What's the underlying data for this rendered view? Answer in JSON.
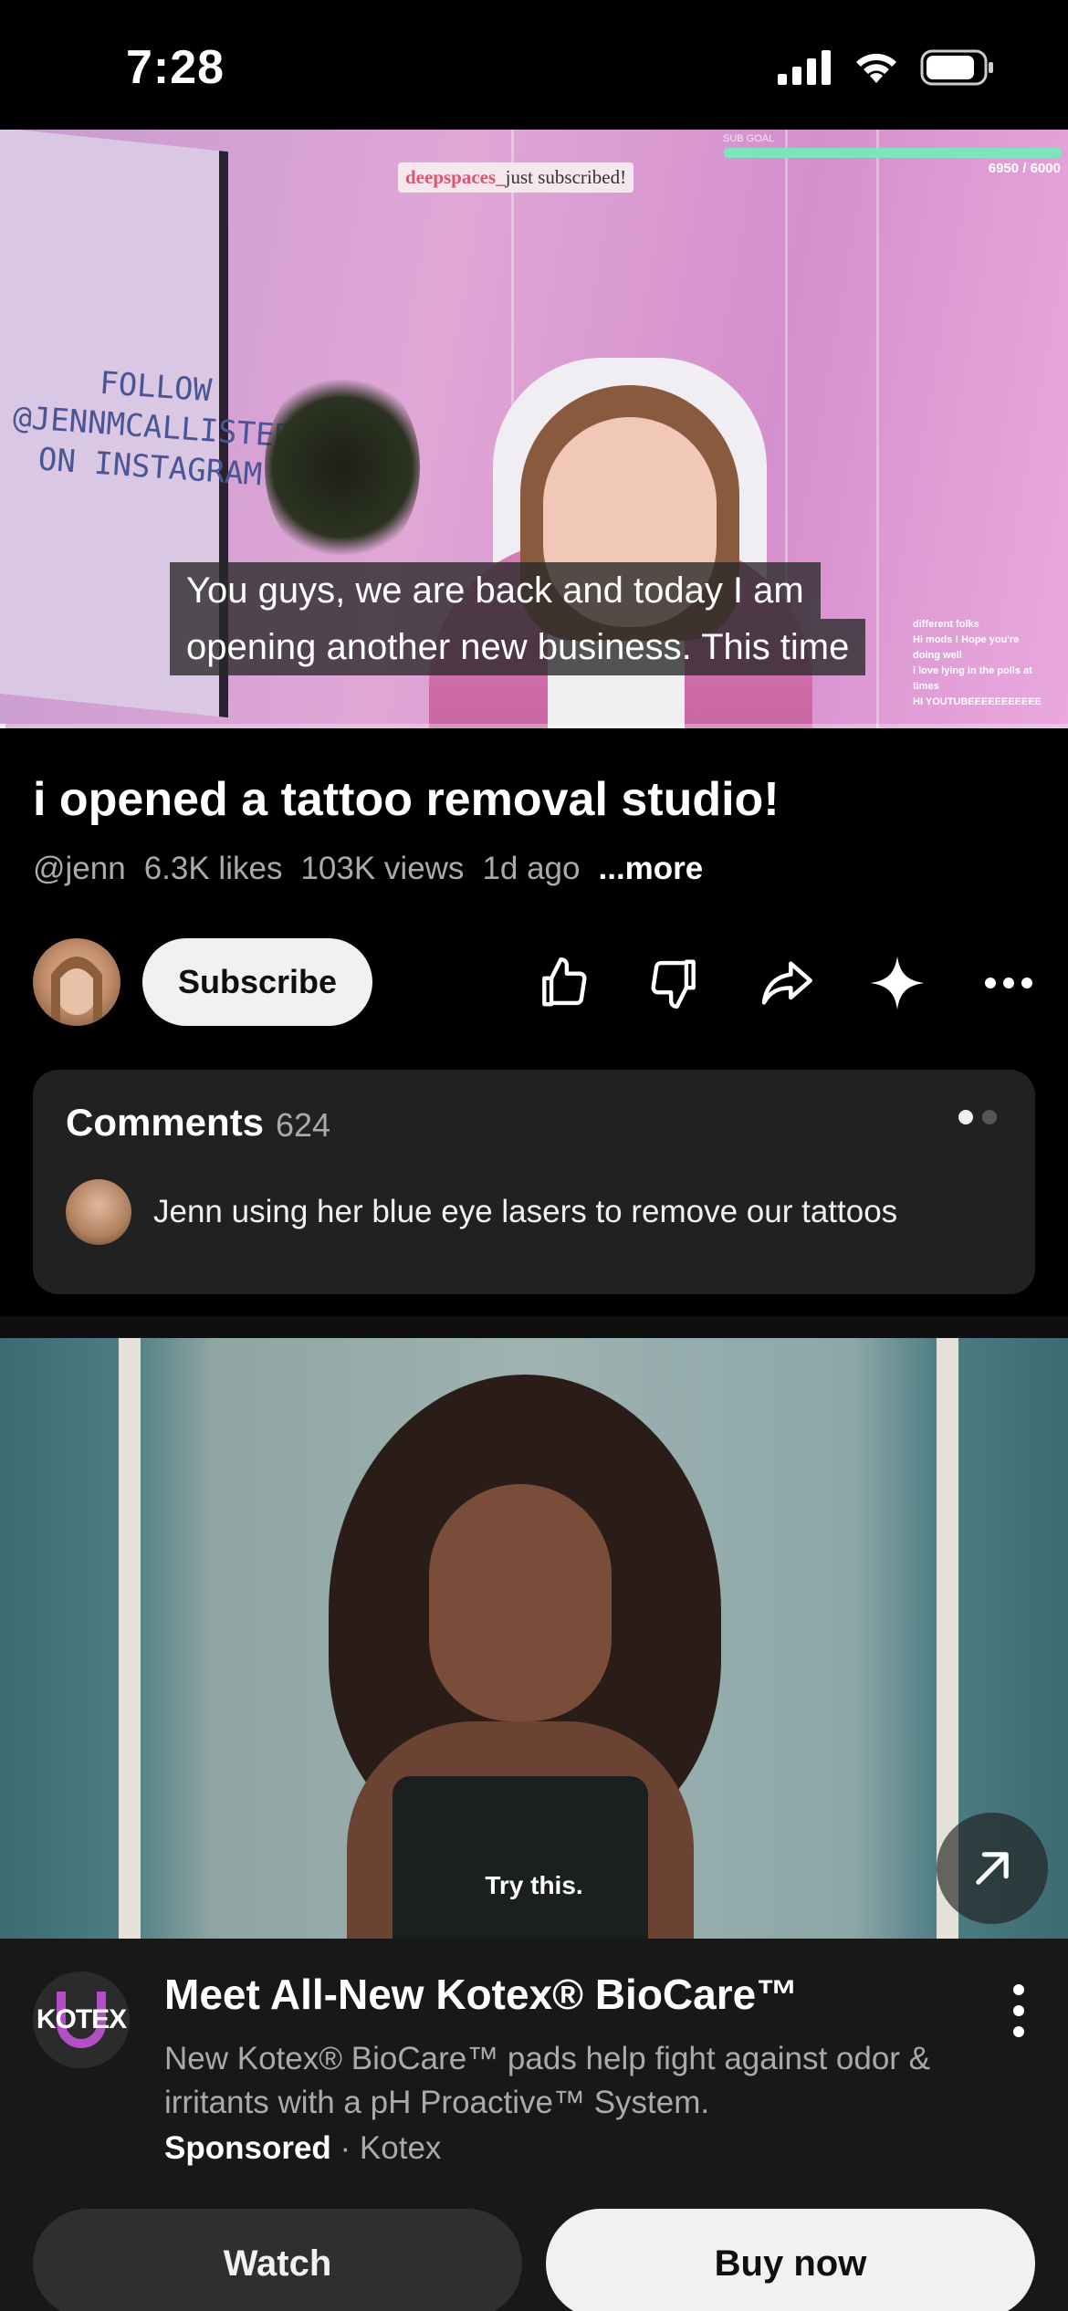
{
  "status_bar": {
    "time": "7:28",
    "icons": [
      "cellular-signal-icon",
      "wifi-icon",
      "battery-icon"
    ]
  },
  "video": {
    "overlay": {
      "sub_goal_label": "SUB GOAL",
      "sub_goal_count": "6950 / 6000",
      "subscriber_alert_name": "deepspaces_",
      "subscriber_alert_text": "just subscribed!",
      "whiteboard_lines": [
        "FOLLOW",
        "@JENNMCALLISTER",
        "ON INSTAGRAM"
      ],
      "chat_lines": [
        "different folks",
        "Hi mods ! Hope you're",
        "doing well",
        "i love lying in the polls at",
        "times",
        "HI YOUTUBEEEEEEEEEEE"
      ]
    },
    "captions": [
      "You guys, we are back and today I am",
      "opening another new business. This time"
    ],
    "progress_fraction": 0.005
  },
  "title_section": {
    "title": "i opened a tattoo removal studio!",
    "channel_handle": "@jenn",
    "likes": "6.3K likes",
    "views": "103K views",
    "age": "1d ago",
    "more_label": "...more"
  },
  "actions": {
    "subscribe_label": "Subscribe",
    "icons": [
      "like-icon",
      "dislike-icon",
      "share-icon",
      "sparkle-icon",
      "more-icon"
    ]
  },
  "comments": {
    "title": "Comments",
    "count": "624",
    "top_comment": "Jenn using her blue eye lasers to remove our tattoos"
  },
  "ad": {
    "video_caption": "Try this.",
    "logo_text": "KOTEX",
    "title": "Meet All-New Kotex® BioCare™",
    "description": "New Kotex® BioCare™ pads help fight against odor & irritants with a pH Proactive™ System.",
    "sponsored_label": "Sponsored",
    "separator": "·",
    "advertiser": "Kotex",
    "watch_label": "Watch",
    "buy_label": "Buy now"
  },
  "colors": {
    "background": "#000000",
    "card": "#212121",
    "secondary_text": "#aaaaaa",
    "sub_goal": "#7fe3bc",
    "alert_name": "#e0546d"
  }
}
